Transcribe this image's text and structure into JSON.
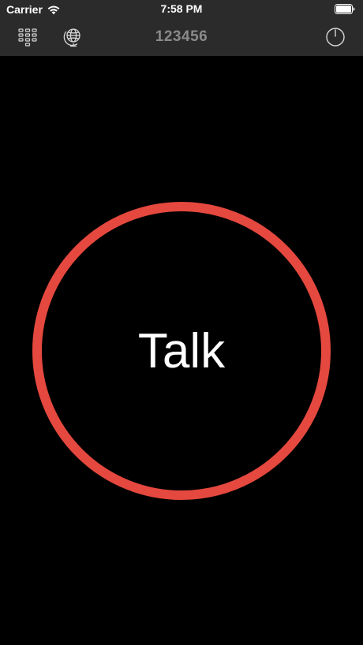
{
  "status_bar": {
    "carrier": "Carrier",
    "time": "7:58 PM",
    "wifi_icon": "wifi-icon",
    "battery_icon": "battery-full-icon"
  },
  "toolbar": {
    "keypad_icon": "keypad-icon",
    "globe_icon": "globe-icon",
    "title": "123456",
    "power_icon": "power-icon"
  },
  "main": {
    "talk_label": "Talk",
    "ring_color": "#e5483e"
  },
  "colors": {
    "background": "#000000",
    "bar_background": "#2b2b2b",
    "title_color": "#8a8a8a"
  }
}
